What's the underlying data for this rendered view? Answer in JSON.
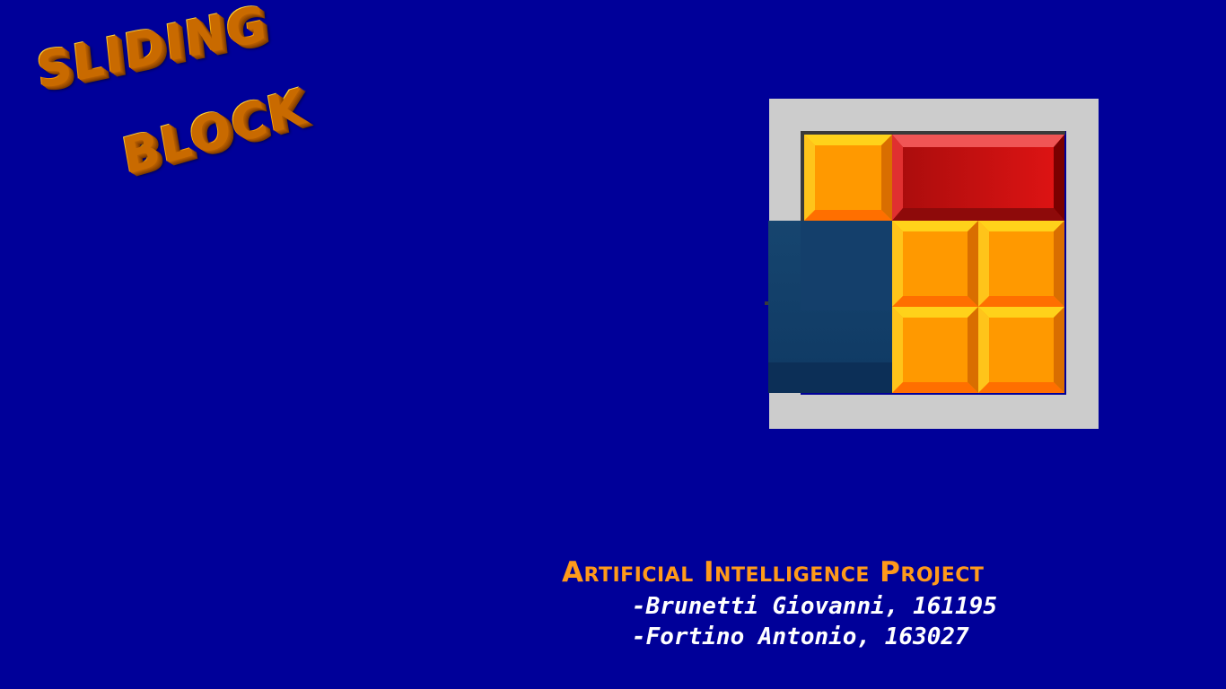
{
  "title": {
    "line1": "SLIDING",
    "line2": "BLOCK"
  },
  "colors": {
    "background": "#000099",
    "title_orange": "#ff9a1a",
    "block_orange": "#ff9900",
    "block_yellow": "#ffd21a",
    "block_red": "#cc1010",
    "empty_cell": "#123d6e",
    "frame_gray": "#cccccc"
  },
  "puzzle_icon": "sliding-block-puzzle-logo",
  "project": {
    "title": "Artificial Intelligence Project",
    "authors": [
      "-Brunetti Giovanni, 161195",
      "-Fortino Antonio, 163027"
    ]
  }
}
